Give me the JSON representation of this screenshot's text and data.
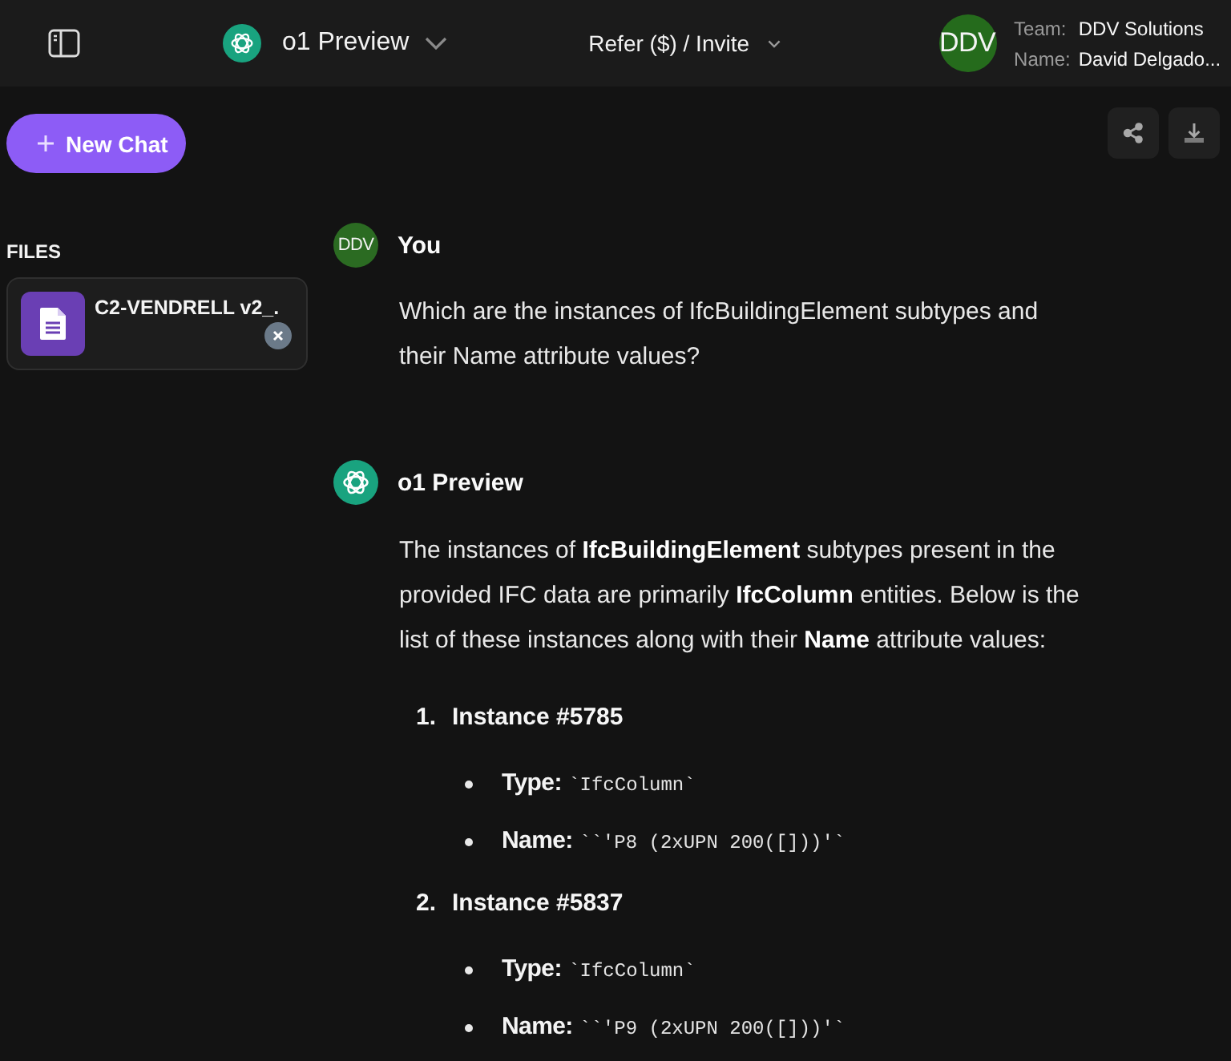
{
  "header": {
    "model": {
      "name": "o1 Preview"
    },
    "refer": {
      "label": "Refer ($) / Invite"
    },
    "account": {
      "initials": "DDV",
      "team_label": "Team:",
      "team": "DDV Solutions",
      "name_label": "Name:",
      "name": "David Delgado..."
    }
  },
  "sidebar": {
    "new_chat": {
      "label": "New Chat"
    },
    "files_title": "FILES",
    "files": [
      {
        "name": "C2-VENDRELL v2_."
      }
    ]
  },
  "messages": [
    {
      "kind": "user",
      "initials": "DDV",
      "author": "You",
      "blocks": [
        {
          "kind": "paragraph",
          "text": "Which are the instances of IfcBuildingElement subtypes and their Name attribute values?"
        }
      ]
    },
    {
      "kind": "assistant",
      "author": "o1 Preview",
      "blocks": [
        {
          "kind": "paragraph",
          "text": "The instances of **IfcBuildingElement** subtypes present in the provided IFC data are primarily **IfcColumn** entities. Below is the list of these instances along with their **Name** attribute values:"
        },
        {
          "kind": "ordered_list",
          "items": [
            {
              "marker": "1.",
              "title": "Instance #5785",
              "fields": [
                {
                  "label": "Type:",
                  "code": "`IfcColumn`"
                },
                {
                  "label": "Name:",
                  "code": "``'P8 (2xUPN 200([]))'`"
                }
              ]
            },
            {
              "marker": "2.",
              "title": "Instance #5837",
              "fields": [
                {
                  "label": "Type:",
                  "code": "`IfcColumn`"
                },
                {
                  "label": "Name:",
                  "code": "``'P9 (2xUPN 200([]))'`"
                }
              ]
            }
          ]
        }
      ]
    }
  ]
}
